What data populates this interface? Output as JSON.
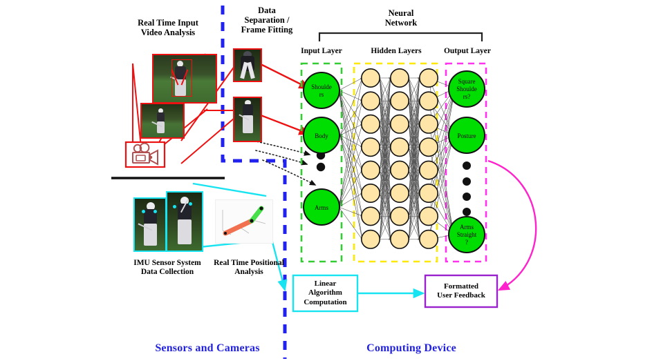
{
  "figure": {
    "type": "system-architecture-diagram",
    "domain": "golf-swing-analysis-pipeline"
  },
  "labels": {
    "real_time_input": "Real Time Input\nVideo Analysis",
    "real_time_input_l1": "Real Time Input",
    "real_time_input_l2": "Video Analysis",
    "data_separation_l1": "Data",
    "data_separation_l2": "Separation /",
    "data_separation_l3": "Frame Fitting",
    "neural_network_l1": "Neural",
    "neural_network_l2": "Network",
    "input_layer": "Input Layer",
    "hidden_layers": "Hidden Layers",
    "output_layer": "Output Layer",
    "imu_l1": "IMU Sensor System",
    "imu_l2": "Data Collection",
    "positional_l1": "Real Time Positional",
    "positional_l2": "Analysis",
    "sensors_and_cameras": "Sensors and Cameras",
    "computing_device": "Computing Device"
  },
  "input_nodes": [
    {
      "label": "Shoulde\nrs",
      "line1": "Shoulde",
      "line2": "rs",
      "line3": ""
    },
    {
      "label": "Body",
      "line1": "Body",
      "line2": "",
      "line3": ""
    },
    {
      "label": "Arms",
      "line1": "Arms",
      "line2": "",
      "line3": ""
    }
  ],
  "output_nodes": [
    {
      "label": "Square Shoulders?",
      "line1": "Square",
      "line2": "Shoulde",
      "line3": "rs?"
    },
    {
      "label": "Posture",
      "line1": "Posture",
      "line2": "",
      "line3": ""
    },
    {
      "label": "Arms Straight?",
      "line1": "Arms",
      "line2": "Straight",
      "line3": "?"
    }
  ],
  "hidden": {
    "layer_count": 3,
    "nodes_per_layer": 8
  },
  "ellipsis": {
    "output_dot_count": 4,
    "input_dot_count": 2
  },
  "boxes": {
    "linear_algorithm": "Linear\nAlgorithm\nComputation",
    "linear_algorithm_l1": "Linear",
    "linear_algorithm_l2": "Algorithm",
    "linear_algorithm_l3": "Computation",
    "formatted_feedback": "Formatted\nUser Feedback",
    "formatted_feedback_l1": "Formatted",
    "formatted_feedback_l2": "User Feedback"
  },
  "icons": {
    "camera": "video-camera-icon"
  },
  "colors": {
    "input_layer_border": "#33cc33",
    "hidden_layer_border": "#ffee00",
    "output_layer_border": "#ff33ee",
    "input_node_fill": "#00dd00",
    "hidden_node_fill": "#ffe5a8",
    "output_node_fill": "#00dd00",
    "divider_blue": "#2222ee",
    "red_accent": "#ee1111",
    "cyan_accent": "#18e3f0",
    "magenta_accent": "#ff22cc",
    "purple_box": "#9922cc",
    "section_text": "#2222dd"
  }
}
